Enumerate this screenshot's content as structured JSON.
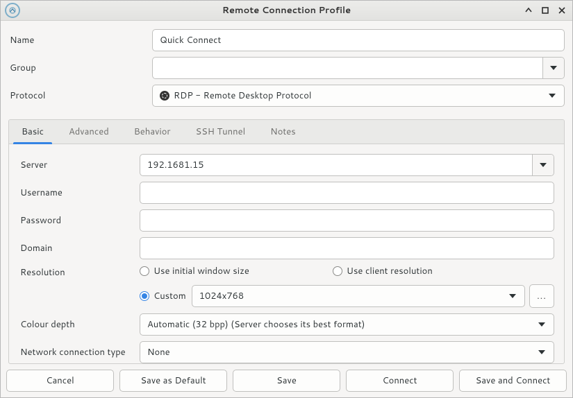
{
  "window": {
    "title": "Remote Connection Profile"
  },
  "top": {
    "name_label": "Name",
    "name_value": "Quick Connect",
    "group_label": "Group",
    "group_value": "",
    "protocol_label": "Protocol",
    "protocol_value": "RDP - Remote Desktop Protocol"
  },
  "tabs": {
    "basic": "Basic",
    "advanced": "Advanced",
    "behavior": "Behavior",
    "ssh": "SSH Tunnel",
    "notes": "Notes"
  },
  "basic": {
    "server_label": "Server",
    "server_value": "192.1681.15",
    "username_label": "Username",
    "username_value": "",
    "password_label": "Password",
    "password_value": "",
    "domain_label": "Domain",
    "domain_value": "",
    "resolution_label": "Resolution",
    "res_initial": "Use initial window size",
    "res_client": "Use client resolution",
    "res_custom_label": "Custom",
    "res_custom_value": "1024x768",
    "res_more": "...",
    "colour_label": "Colour depth",
    "colour_value": "Automatic (32 bpp) (Server chooses its best format)",
    "net_label": "Network connection type",
    "net_value": "None"
  },
  "buttons": {
    "cancel": "Cancel",
    "save_default": "Save as Default",
    "save": "Save",
    "connect": "Connect",
    "save_connect": "Save and Connect"
  }
}
